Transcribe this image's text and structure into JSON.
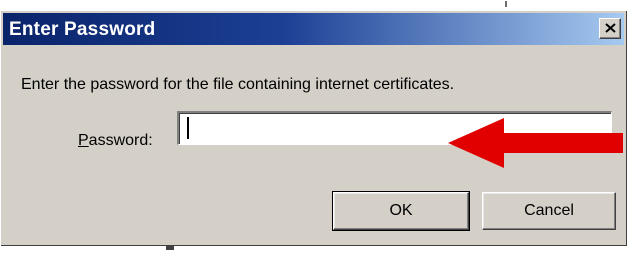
{
  "dialog": {
    "title": "Enter Password",
    "close_icon": "close-x-icon",
    "message": "Enter the password for the file containing internet certificates.",
    "password_label_mnemonic": "P",
    "password_label_rest": "assword:",
    "password_value": "",
    "ok_label": "OK",
    "cancel_label": "Cancel"
  },
  "annotation": {
    "arrow_icon": "red-arrow-left-icon",
    "arrow_color": "#e00000"
  },
  "colors": {
    "titlebar_start": "#0a246a",
    "titlebar_end": "#a6caf0",
    "dialog_face": "#d4d0c8"
  }
}
